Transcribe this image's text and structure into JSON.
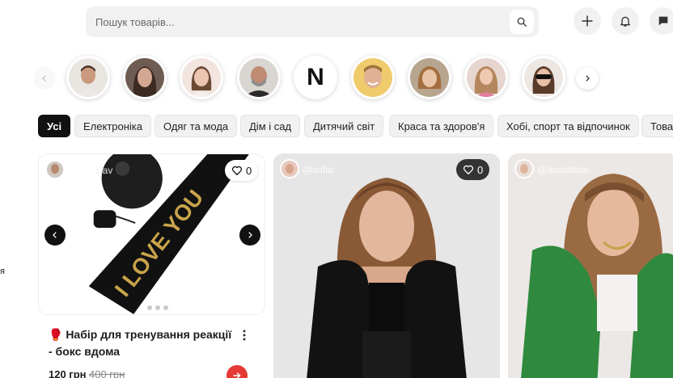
{
  "search": {
    "placeholder": "Пошук товарів..."
  },
  "header": {
    "icons": [
      "plus-icon",
      "bell-icon",
      "chat-icon"
    ]
  },
  "stories": {
    "items": [
      {
        "name": "story-1",
        "kind": "avatar"
      },
      {
        "name": "story-2",
        "kind": "avatar"
      },
      {
        "name": "story-3",
        "kind": "avatar"
      },
      {
        "name": "story-4",
        "kind": "avatar"
      },
      {
        "name": "story-5",
        "kind": "logo",
        "logo_text": "N"
      },
      {
        "name": "story-6",
        "kind": "avatar"
      },
      {
        "name": "story-7",
        "kind": "avatar"
      },
      {
        "name": "story-8",
        "kind": "avatar"
      },
      {
        "name": "story-9",
        "kind": "avatar"
      }
    ]
  },
  "categories": [
    {
      "label": "Усі",
      "active": true
    },
    {
      "label": "Електроніка"
    },
    {
      "label": "Одяг та мода"
    },
    {
      "label": "Дім і сад"
    },
    {
      "label": "Дитячий світ"
    },
    {
      "label": "Краса та здоров'я"
    },
    {
      "label": "Хобі, спорт та відпочинок"
    },
    {
      "label": "Товари"
    }
  ],
  "side_text": "я",
  "cards": [
    {
      "username": "slav",
      "likes": "0",
      "title": "🥊 Набір для тренування реакції - бокс вдома",
      "price": "120 грн",
      "old_price": "400 грн",
      "product_text": "I LOVE YOU"
    },
    {
      "username": "@sofia",
      "likes": "0"
    },
    {
      "username": "@anastasia"
    }
  ],
  "colors": {
    "accent": "#e53935",
    "chip_active": "#111111",
    "chip_bg": "#f1f1f2"
  }
}
